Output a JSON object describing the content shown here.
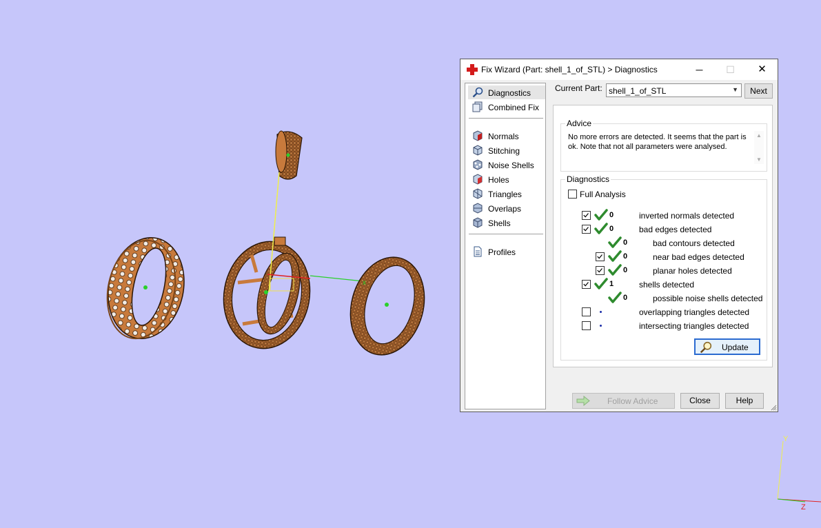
{
  "window": {
    "title": "Fix Wizard (Part: shell_1_of_STL) > Diagnostics",
    "minimize": "─",
    "maximize": "☐",
    "close": "✕"
  },
  "nav": {
    "items": [
      {
        "label": "Diagnostics",
        "icon": "magnifier-icon",
        "selected": true
      },
      {
        "label": "Combined Fix",
        "icon": "combined-fix-icon"
      },
      {
        "label": "Normals",
        "icon": "normals-cube-icon"
      },
      {
        "label": "Stitching",
        "icon": "stitching-cube-icon"
      },
      {
        "label": "Noise Shells",
        "icon": "noise-shells-icon"
      },
      {
        "label": "Holes",
        "icon": "holes-cube-icon"
      },
      {
        "label": "Triangles",
        "icon": "triangles-cube-icon"
      },
      {
        "label": "Overlaps",
        "icon": "overlaps-cube-icon"
      },
      {
        "label": "Shells",
        "icon": "shells-cube-icon"
      },
      {
        "label": "Profiles",
        "icon": "profiles-document-icon"
      }
    ]
  },
  "current_part": {
    "label": "Current Part:",
    "value": "shell_1_of_STL",
    "next_label": "Next"
  },
  "advice": {
    "title": "Advice",
    "text": "No more errors are detected. It seems that the part is ok. Note that not all parameters were analysed."
  },
  "diagnostics": {
    "title": "Diagnostics",
    "full_analysis_label": "Full Analysis",
    "full_analysis_checked": false,
    "rows": [
      {
        "label": "inverted normals detected",
        "count": "0",
        "checked": true,
        "status": "ok",
        "indent": 0,
        "has_checkbox": true
      },
      {
        "label": "bad edges detected",
        "count": "0",
        "checked": true,
        "status": "ok",
        "indent": 0,
        "has_checkbox": true
      },
      {
        "label": "bad contours detected",
        "count": "0",
        "checked": false,
        "status": "ok",
        "indent": 2,
        "has_checkbox": false
      },
      {
        "label": "near bad edges detected",
        "count": "0",
        "checked": true,
        "status": "ok",
        "indent": 1,
        "has_checkbox": true
      },
      {
        "label": "planar holes detected",
        "count": "0",
        "checked": true,
        "status": "ok",
        "indent": 1,
        "has_checkbox": true
      },
      {
        "label": "shells detected",
        "count": "1",
        "checked": true,
        "status": "ok",
        "indent": 0,
        "has_checkbox": true
      },
      {
        "label": "possible noise shells detected",
        "count": "0",
        "checked": false,
        "status": "ok",
        "indent": 2,
        "has_checkbox": false
      },
      {
        "label": "overlapping triangles detected",
        "count": "",
        "checked": false,
        "status": "pending",
        "indent": 0,
        "has_checkbox": true
      },
      {
        "label": "intersecting triangles detected",
        "count": "",
        "checked": false,
        "status": "pending",
        "indent": 0,
        "has_checkbox": true
      }
    ],
    "update_label": "Update"
  },
  "footer": {
    "follow_advice_label": "Follow Advice",
    "close_label": "Close",
    "help_label": "Help"
  },
  "viewport": {
    "background": "#c6c6fa",
    "part_color": "#c87a3c",
    "axis_y_label": "Y",
    "axis_z_label": "Z"
  }
}
